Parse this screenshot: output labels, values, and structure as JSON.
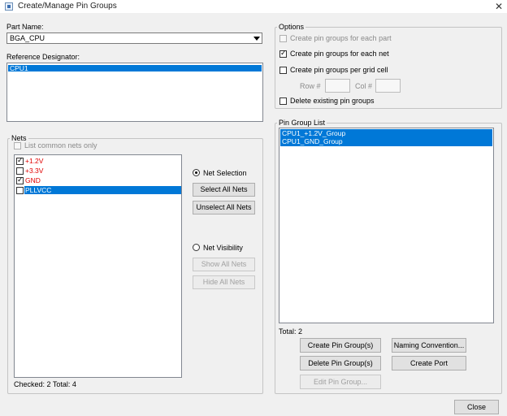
{
  "window": {
    "title": "Create/Manage Pin Groups"
  },
  "part_name": {
    "label": "Part Name:",
    "value": "BGA_CPU"
  },
  "reference_designator": {
    "label": "Reference Designator:",
    "items": [
      "CPU1"
    ]
  },
  "nets": {
    "title": "Nets",
    "list_common_label": "List common nets only",
    "items": [
      {
        "label": "+1.2V",
        "checked": true,
        "color": "#e00000"
      },
      {
        "label": "+3.3V",
        "checked": false,
        "color": "#e00000"
      },
      {
        "label": "GND",
        "checked": true,
        "color": "#e00000"
      },
      {
        "label": "PLLVCC",
        "checked": false,
        "color": "#ffffff"
      }
    ],
    "net_selection_label": "Net Selection",
    "select_all_label": "Select All Nets",
    "unselect_all_label": "Unselect All Nets",
    "net_visibility_label": "Net Visibility",
    "show_all_label": "Show All Nets",
    "hide_all_label": "Hide All Nets",
    "status": "Checked: 2 Total: 4"
  },
  "options": {
    "title": "Options",
    "each_part_label": "Create pin groups for each part",
    "each_net_label": "Create pin groups for each net",
    "grid_cell_label": "Create pin groups per grid cell",
    "row_label": "Row #",
    "col_label": "Col #",
    "delete_existing_label": "Delete existing pin groups"
  },
  "pin_group_list": {
    "title": "Pin Group List",
    "items": [
      "CPU1_+1.2V_Group",
      "CPU1_GND_Group"
    ],
    "total": "Total: 2"
  },
  "buttons": {
    "create_pin_groups": "Create Pin Group(s)",
    "naming_convention": "Naming Convention...",
    "delete_pin_groups": "Delete Pin Group(s)",
    "create_port": "Create Port",
    "edit_pin_group": "Edit Pin Group...",
    "close": "Close"
  }
}
